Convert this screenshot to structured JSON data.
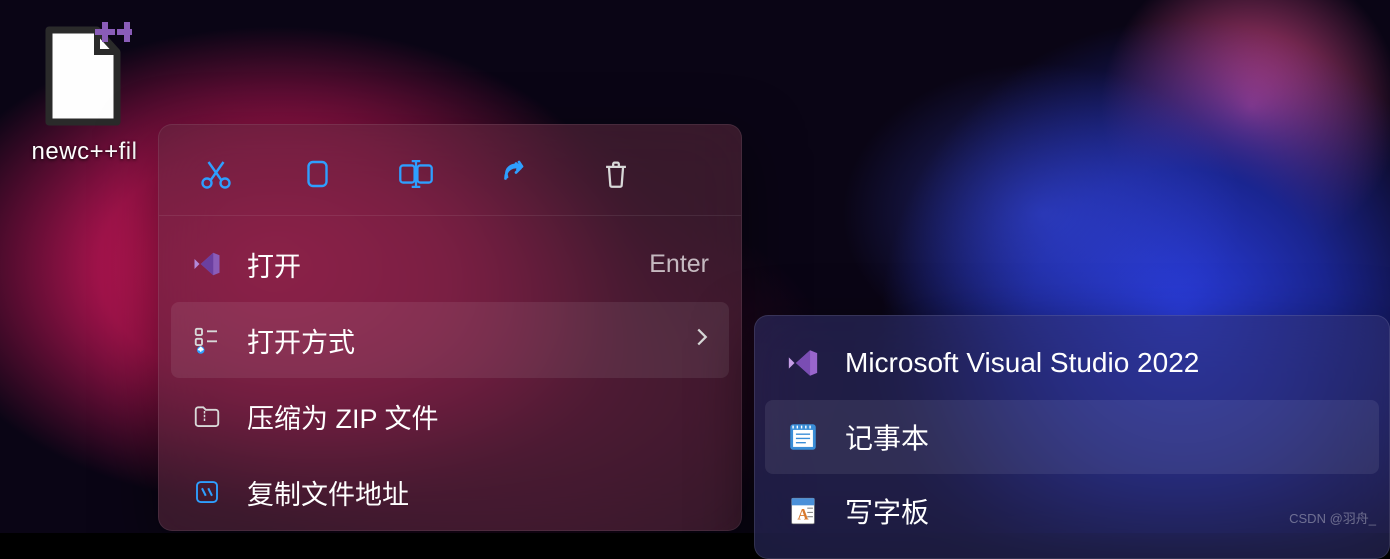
{
  "desktop": {
    "file_label": "newc++fil"
  },
  "context_menu": {
    "top_actions": [
      "cut",
      "copy",
      "rename",
      "share",
      "delete"
    ],
    "items": [
      {
        "icon": "vs-icon",
        "label": "打开",
        "shortcut": "Enter"
      },
      {
        "icon": "openwith-icon",
        "label": "打开方式",
        "submenu": true
      },
      {
        "icon": "zip-icon",
        "label": "压缩为 ZIP 文件"
      },
      {
        "icon": "copypath-icon",
        "label": "复制文件地址"
      }
    ]
  },
  "submenu": {
    "items": [
      {
        "icon": "vs-icon",
        "label": "Microsoft Visual Studio 2022"
      },
      {
        "icon": "notepad-icon",
        "label": "记事本",
        "highlighted": true
      },
      {
        "icon": "wordpad-icon",
        "label": "写字板"
      }
    ]
  },
  "watermark": "CSDN @羽舟_"
}
